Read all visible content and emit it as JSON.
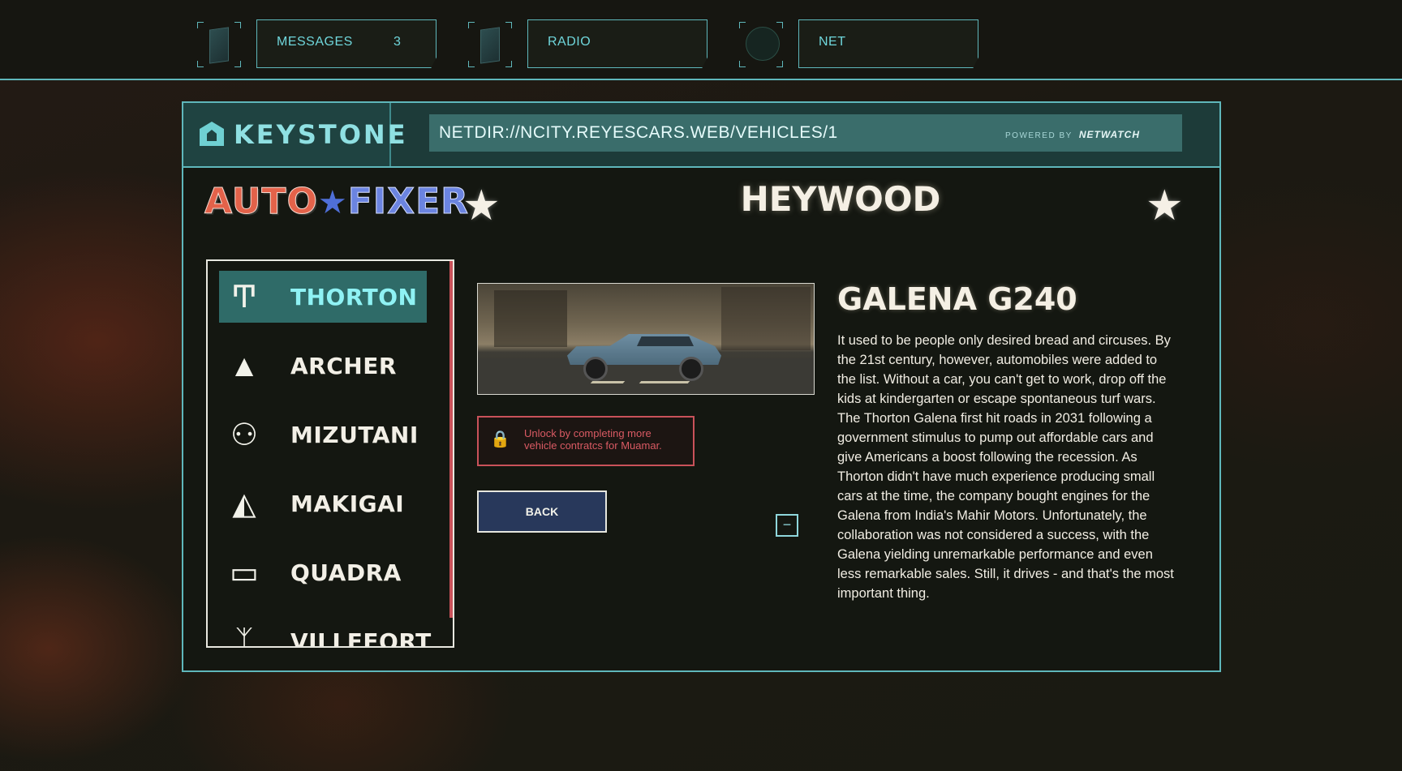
{
  "topbar": {
    "messages_label": "MESSAGES",
    "messages_count": "3",
    "radio_label": "RADIO",
    "net_label": "NET"
  },
  "browser": {
    "logo_text": "KEYSTONE",
    "url": "NETDIR://NCITY.REYESCARS.WEB/VEHICLES/1",
    "powered_by_prefix": "POWERED BY",
    "powered_by_brand": "NETWATCH"
  },
  "site": {
    "brand_auto": "AUTO",
    "brand_star": "★",
    "brand_fixer": "FIXER",
    "star_glyph": "★",
    "page_title": "HEYWOOD"
  },
  "manufacturers": [
    {
      "label": "THORTON",
      "icon": "thorton-logo-icon",
      "glyph": "Ͳ"
    },
    {
      "label": "ARCHER",
      "icon": "archer-logo-icon",
      "glyph": "▲"
    },
    {
      "label": "MIZUTANI",
      "icon": "mizutani-logo-icon",
      "glyph": "⚇"
    },
    {
      "label": "MAKIGAI",
      "icon": "makigai-logo-icon",
      "glyph": "◭"
    },
    {
      "label": "QUADRA",
      "icon": "quadra-logo-icon",
      "glyph": "▭"
    },
    {
      "label": "VILLEFORT",
      "icon": "villefort-logo-icon",
      "glyph": "ᛉ"
    }
  ],
  "vehicle": {
    "name": "GALENA G240",
    "lock_message": "Unlock by completing more vehicle contratcs for Muamar.",
    "lock_glyph": "🔒",
    "back_label": "BACK",
    "minus_glyph": "−",
    "description": "It used to be people only desired bread and circuses. By the 21st century, however, automobiles were added to the list. Without a car, you can't get to work, drop off the kids at kindergarten or escape spontaneous turf wars. The Thorton Galena first hit roads in 2031 following a government stimulus to pump out affordable cars and give Americans a boost following the recession. As Thorton didn't have much experience producing small cars at the time, the company bought engines for the Galena from India's Mahir Motors. Unfortunately, the collaboration was not considered a success, with the Galena yielding unremarkable performance and even less remarkable sales. Still, it drives - and that's the most important thing."
  },
  "colors": {
    "accent": "#5fb7bb",
    "active_item": "#2f6b68",
    "alert": "#c9525a",
    "button": "#28385b"
  }
}
